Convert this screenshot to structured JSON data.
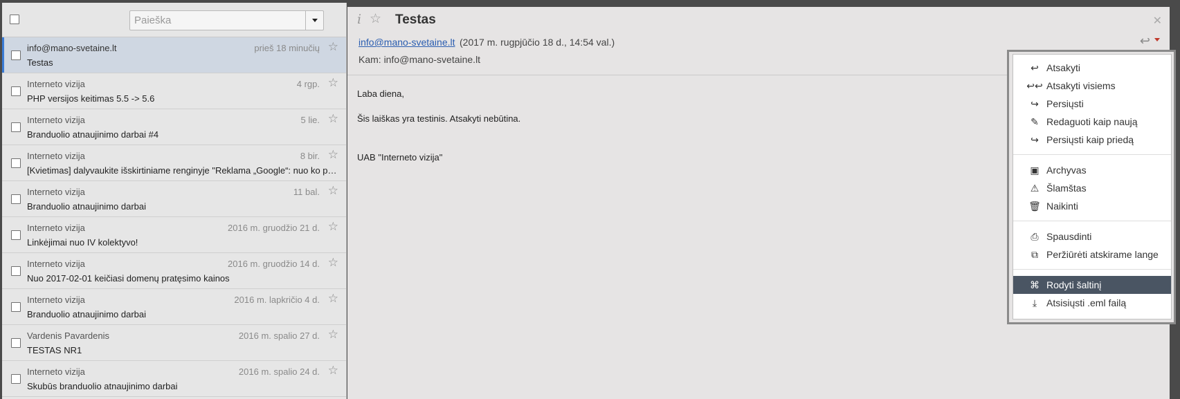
{
  "search": {
    "placeholder": "Paieška"
  },
  "messages": [
    {
      "from": "info@mano-svetaine.lt",
      "date": "prieš 18 minučių",
      "subject": "Testas"
    },
    {
      "from": "Interneto vizija",
      "date": "4 rgp.",
      "subject": "PHP versijos keitimas 5.5 -> 5.6"
    },
    {
      "from": "Interneto vizija",
      "date": "5 lie.",
      "subject": "Branduolio atnaujinimo darbai #4"
    },
    {
      "from": "Interneto vizija",
      "date": "8 bir.",
      "subject": "[Kvietimas] dalyvaukite išskirtiniame renginyje \"Reklama „Google“: nuo ko pradėti\""
    },
    {
      "from": "Interneto vizija",
      "date": "11 bal.",
      "subject": "Branduolio atnaujinimo darbai"
    },
    {
      "from": "Interneto vizija",
      "date": "2016 m. gruodžio 21 d.",
      "subject": "Linkėjimai nuo IV kolektyvo!"
    },
    {
      "from": "Interneto vizija",
      "date": "2016 m. gruodžio 14 d.",
      "subject": "Nuo 2017-02-01 keičiasi domenų pratęsimo kainos"
    },
    {
      "from": "Interneto vizija",
      "date": "2016 m. lapkričio 4 d.",
      "subject": "Branduolio atnaujinimo darbai"
    },
    {
      "from": "Vardenis Pavardenis",
      "date": "2016 m. spalio 27 d.",
      "subject": "TESTAS NR1"
    },
    {
      "from": "Interneto vizija",
      "date": "2016 m. spalio 24 d.",
      "subject": "Skubūs branduolio atnaujinimo darbai"
    }
  ],
  "preview": {
    "title": "Testas",
    "from": "info@mano-svetaine.lt",
    "when": "(2017 m. rugpjūčio 18 d., 14:54 val.)",
    "to": "Kam: info@mano-svetaine.lt",
    "body": {
      "greeting": "Laba diena,",
      "line1": "Šis laiškas yra testinis. Atsakyti nebūtina.",
      "signature": "UAB \"Interneto vizija\""
    }
  },
  "menu": {
    "reply": "Atsakyti",
    "reply_all": "Atsakyti visiems",
    "forward": "Persiųsti",
    "edit_as_new": "Redaguoti kaip naują",
    "forward_attachment": "Persiųsti kaip priedą",
    "archive": "Archyvas",
    "spam": "Šlamštas",
    "delete": "Naikinti",
    "print": "Spausdinti",
    "open_window": "Peržiūrėti atskirame lange",
    "show_source": "Rodyti šaltinį",
    "download_eml": "Atsisiųsti .eml failą"
  },
  "colors": {
    "accent": "#3a7bd5",
    "menu_active": "#4a5563",
    "link": "#2a5db0"
  }
}
